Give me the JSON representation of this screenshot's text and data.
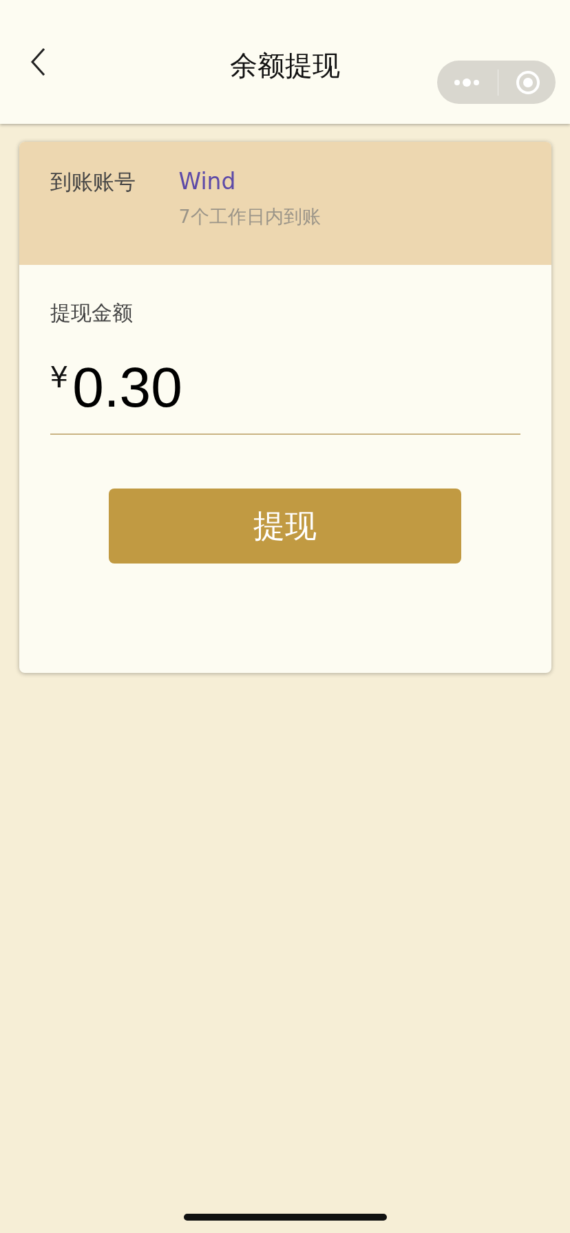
{
  "header": {
    "title": "余额提现"
  },
  "account": {
    "label": "到账账号",
    "name": "Wind",
    "note": "7个工作日内到账"
  },
  "amount": {
    "label": "提现金额",
    "currency": "¥",
    "value": "0.30"
  },
  "submit": {
    "label": "提现"
  }
}
